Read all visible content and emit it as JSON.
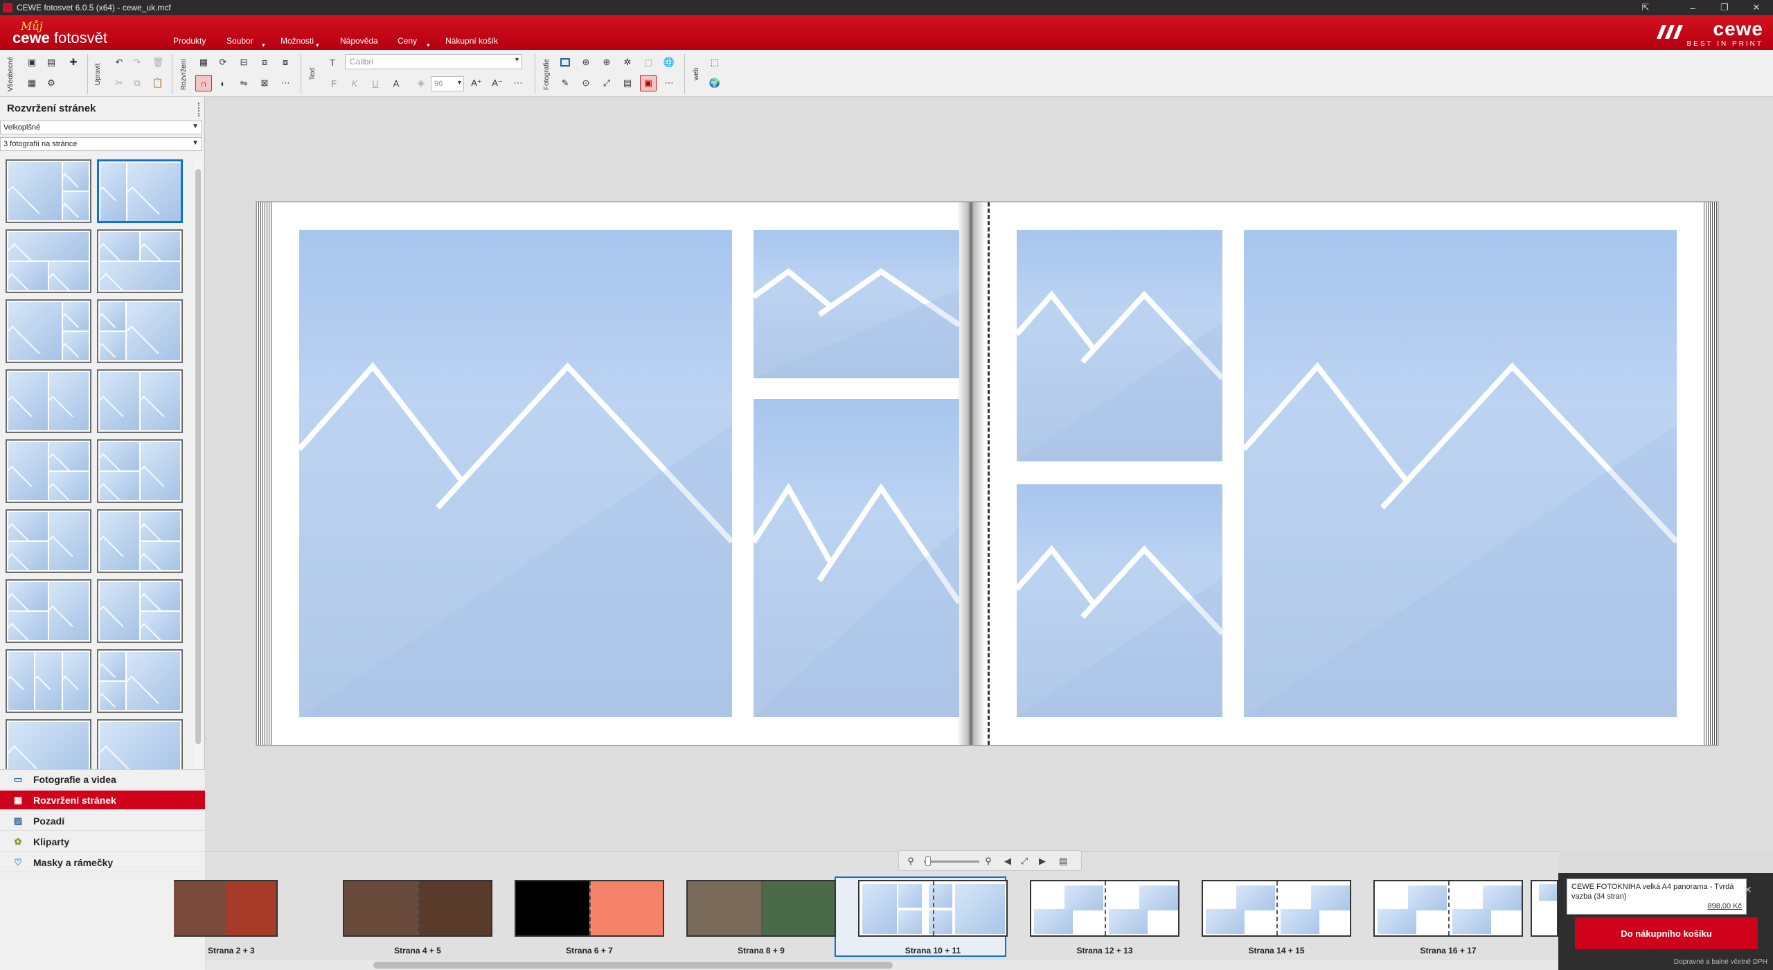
{
  "window": {
    "title": "CEWE fotosvet 6.0.5 (x64) - cewe_uk.mcf",
    "min": "–",
    "restore": "❐",
    "close": "✕",
    "extra": "⇱"
  },
  "logo": {
    "moj": "Můj",
    "cewe": "cewe",
    "fotosvet": " fotosvět"
  },
  "brand": {
    "name": "cewe",
    "tagline": "BEST IN PRINT"
  },
  "menu": [
    "Produkty",
    "Soubor",
    "Možnosti",
    "Nápověda",
    "Ceny",
    "Nákupní košík"
  ],
  "toolbar": {
    "groups": [
      "Všeobecné",
      "Upravit",
      "Rozvržení",
      "Text",
      "Fotografie",
      "web"
    ],
    "font": "Calibri",
    "font_size": "96",
    "bold": "F",
    "italic": "K",
    "underline": "U"
  },
  "left_panel": {
    "title": "Rozvržení stránek",
    "filter1": "Velkoplšné",
    "filter2": "3 fotografií na stránce",
    "expand": "»"
  },
  "nav_tabs": [
    {
      "label": "Fotografie a videa",
      "icon": "photos-icon"
    },
    {
      "label": "Rozvržení stránek",
      "icon": "layout-icon",
      "active": true
    },
    {
      "label": "Pozadí",
      "icon": "background-icon"
    },
    {
      "label": "Kliparty",
      "icon": "clipart-icon"
    },
    {
      "label": "Masky a rámečky",
      "icon": "masks-icon"
    }
  ],
  "filmstrip": [
    {
      "label": "Strana 2 + 3"
    },
    {
      "label": "Strana 4 + 5"
    },
    {
      "label": "Strana 6 + 7"
    },
    {
      "label": "Strana 8 + 9"
    },
    {
      "label": "Strana 10 + 11",
      "selected": true
    },
    {
      "label": "Strana 12 + 13"
    },
    {
      "label": "Strana 14 + 15"
    },
    {
      "label": "Strana 16 + 17"
    }
  ],
  "cart": {
    "product": "CEWE FOTOKNIHA velká A4 panorama - Tvrdá vazba  (34 stran)",
    "price": "898,00 Kč",
    "button": "Do nákupního košíku",
    "note": "Dopravné a balné včetně DPH"
  },
  "colors": {
    "accent": "#d0021b",
    "selection": "#0a72d8",
    "placeholder": "#b1c9e8"
  }
}
